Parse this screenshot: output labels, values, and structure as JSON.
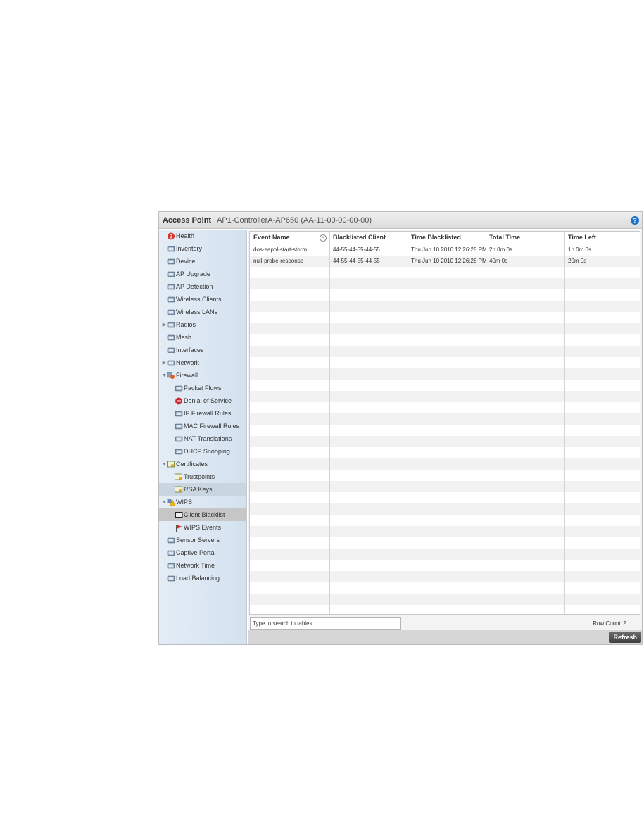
{
  "header": {
    "section_label": "Access Point",
    "device_name": "AP1-ControllerA-AP650 (AA-11-00-00-00-00)",
    "help_icon": "?"
  },
  "sidebar": {
    "items": [
      {
        "label": "Health",
        "icon": "health-icon"
      },
      {
        "label": "Inventory",
        "icon": "inventory-icon"
      },
      {
        "label": "Device",
        "icon": "device-icon"
      },
      {
        "label": "AP Upgrade",
        "icon": "ap-upgrade-icon"
      },
      {
        "label": "AP Detection",
        "icon": "ap-detection-icon"
      },
      {
        "label": "Wireless Clients",
        "icon": "wireless-clients-icon"
      },
      {
        "label": "Wireless LANs",
        "icon": "wireless-lans-icon"
      },
      {
        "label": "Radios",
        "icon": "radios-icon"
      },
      {
        "label": "Mesh",
        "icon": "mesh-icon"
      },
      {
        "label": "Interfaces",
        "icon": "interfaces-icon"
      },
      {
        "label": "Network",
        "icon": "network-icon"
      },
      {
        "label": "Firewall",
        "icon": "firewall-icon"
      },
      {
        "label": "Packet Flows",
        "icon": "packet-flows-icon"
      },
      {
        "label": "Denial of Service",
        "icon": "denial-of-service-icon"
      },
      {
        "label": "IP Firewall Rules",
        "icon": "ip-firewall-rules-icon"
      },
      {
        "label": "MAC Firewall Rules",
        "icon": "mac-firewall-rules-icon"
      },
      {
        "label": "NAT Translations",
        "icon": "nat-translations-icon"
      },
      {
        "label": "DHCP Snooping",
        "icon": "dhcp-snooping-icon"
      },
      {
        "label": "Certificates",
        "icon": "certificates-icon"
      },
      {
        "label": "Trustpoints",
        "icon": "trustpoints-icon"
      },
      {
        "label": "RSA Keys",
        "icon": "rsa-keys-icon"
      },
      {
        "label": "WIPS",
        "icon": "wips-icon"
      },
      {
        "label": "Client Blacklist",
        "icon": "client-blacklist-icon"
      },
      {
        "label": "WIPS Events",
        "icon": "wips-events-icon"
      },
      {
        "label": "Sensor Servers",
        "icon": "sensor-servers-icon"
      },
      {
        "label": "Captive Portal",
        "icon": "captive-portal-icon"
      },
      {
        "label": "Network Time",
        "icon": "network-time-icon"
      },
      {
        "label": "Load Balancing",
        "icon": "load-balancing-icon"
      }
    ]
  },
  "table": {
    "columns": [
      "Event Name",
      "Blacklisted Client",
      "Time Blacklisted",
      "Total Time",
      "Time Left"
    ],
    "rows": [
      [
        "dos-eapol-start-storm",
        "44-55-44-55-44-55",
        "Thu Jun 10 2010 12:26:28 PM",
        "2h 0m 0s",
        "1h 0m 0s"
      ],
      [
        "null-probe-response",
        "44-55-44-55-44-55",
        "Thu Jun 10 2010 12:26:28 PM",
        "40m 0s",
        "20m 0s"
      ]
    ]
  },
  "search": {
    "placeholder": "Type to search in tables"
  },
  "row_count": {
    "label": "Row Count:",
    "value": "2"
  },
  "footer": {
    "refresh_label": "Refresh"
  },
  "colors": {
    "sidebar_bg": "#dce7f2",
    "selected_item": "#c6c6c6",
    "help_blue": "#1a73c9",
    "refresh_bg": "#555555"
  }
}
